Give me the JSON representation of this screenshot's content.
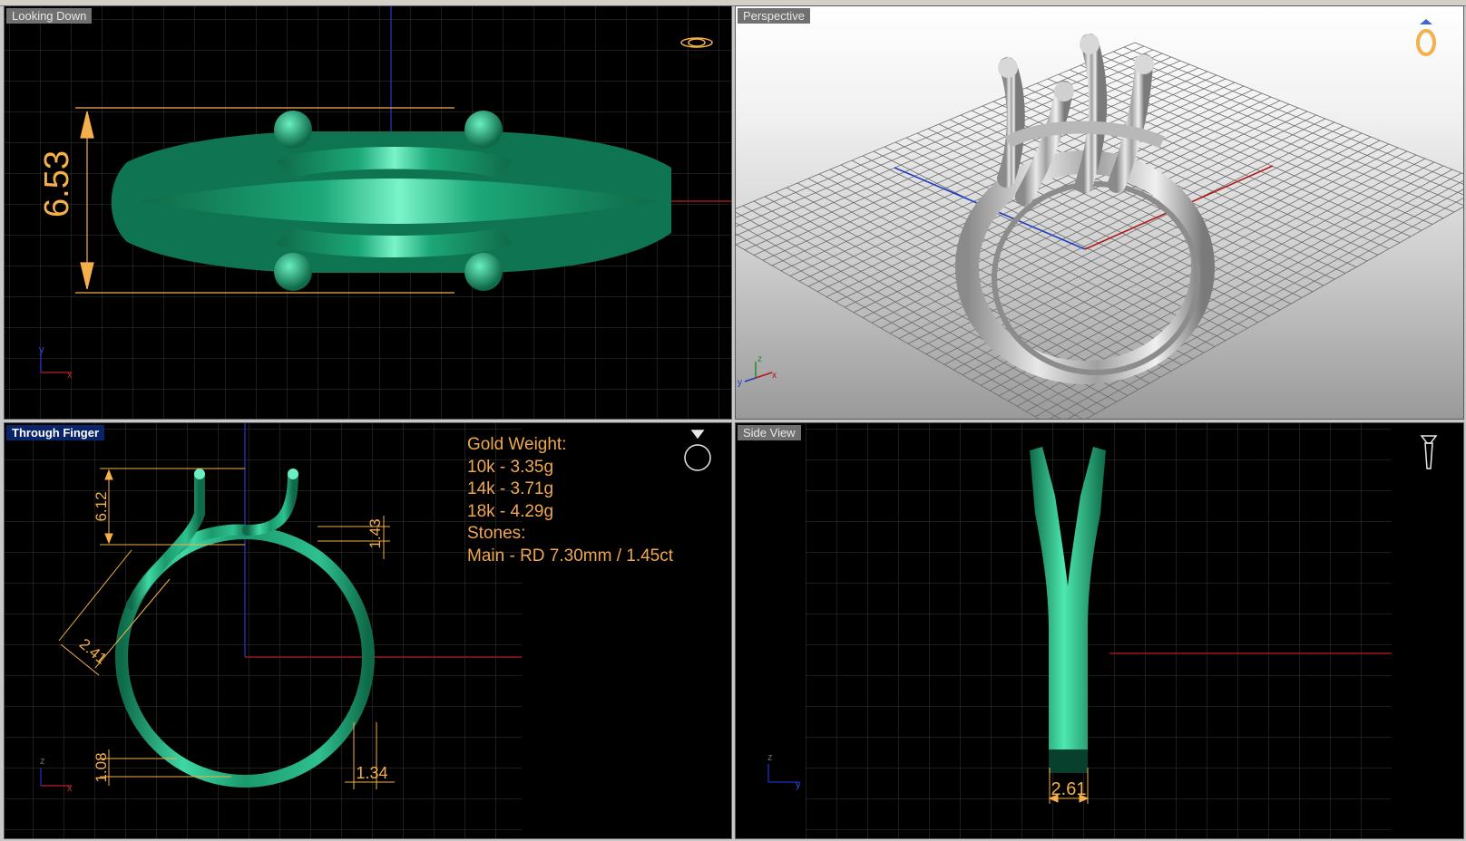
{
  "viewports": {
    "top": {
      "title": "Looking Down",
      "dimension": "6.53"
    },
    "perspective": {
      "title": "Perspective"
    },
    "front": {
      "title": "Through Finger",
      "dimensions": {
        "prong_height": "6.12",
        "band_top": "1.43",
        "shoulder": "2.41",
        "band_bottom": "1.08",
        "band_width": "1.34"
      }
    },
    "right": {
      "title": "Side View",
      "dimension": "2.61"
    }
  },
  "info": {
    "gold_weight_label": "Gold Weight:",
    "weights": [
      "10k - 3.35g",
      "14k - 3.71g",
      "18k - 4.29g"
    ],
    "stones_label": "Stones:",
    "main_stone": "Main - RD 7.30mm / 1.45ct"
  },
  "axes": {
    "x": "x",
    "y": "y",
    "z": "z"
  },
  "colors": {
    "metal_green": "#1a9a6c",
    "metal_highlight": "#6af0c0",
    "dimension": "#f4b04a",
    "grid": "#3c3c3c",
    "axis_x": "#a01818",
    "axis_y": "#1828a8",
    "active_title": "#0a246a"
  },
  "icons": [
    "ring-top-icon",
    "ring-perspective-icon",
    "ring-front-icon",
    "ring-side-icon"
  ]
}
